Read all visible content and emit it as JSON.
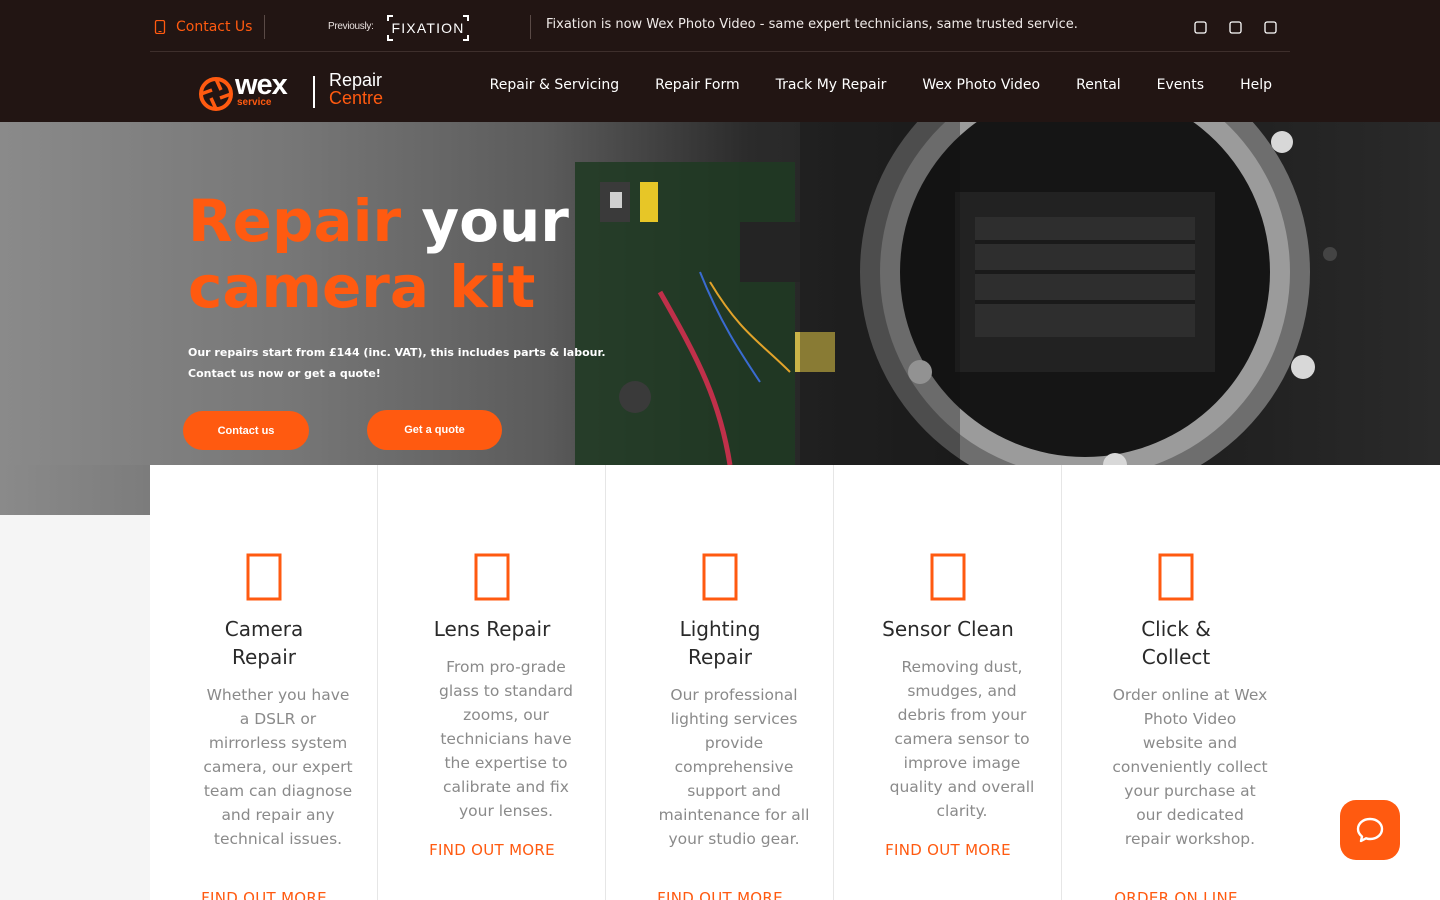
{
  "topbar": {
    "contact_label": "Contact Us",
    "previously_label": "Previously:",
    "previous_brand": "FIXATION",
    "notice": "Fixation is now Wex Photo Video - same expert technicians, same trusted service.",
    "social_icons": [
      "facebook-icon",
      "instagram-icon",
      "twitter-icon"
    ]
  },
  "logo": {
    "brand": "wex",
    "sub": "service",
    "line1": "Repair",
    "line2": "Centre"
  },
  "nav": {
    "items": [
      {
        "label": "Repair & Servicing"
      },
      {
        "label": "Repair Form"
      },
      {
        "label": "Track My Repair"
      },
      {
        "label": "Wex Photo Video"
      },
      {
        "label": "Rental"
      },
      {
        "label": "Events"
      },
      {
        "label": "Help"
      }
    ]
  },
  "hero": {
    "headline_1a": "Repair",
    "headline_1b": " your",
    "headline_2": "camera kit",
    "sub_line1": "Our repairs start from £144 (inc. VAT), this includes parts & labour.",
    "sub_line2": "Contact us now or get a quote!",
    "contact_button": "Contact us",
    "quote_button": "Get a quote"
  },
  "services": [
    {
      "icon": "camera-icon",
      "title": "Camera Repair",
      "desc": "Whether you have a DSLR or mirrorless system camera, our expert team can diagnose and repair any technical issues.",
      "link": "FIND OUT MORE"
    },
    {
      "icon": "lens-icon",
      "title": "Lens Repair",
      "desc": "From pro-grade glass to standard zooms, our technicians have the expertise to calibrate and fix your lenses.",
      "link": "FIND OUT MORE"
    },
    {
      "icon": "lightbulb-icon",
      "title": "Lighting Repair",
      "desc": "Our professional lighting services provide comprehensive support and maintenance for all your studio gear.",
      "link": "FIND OUT MORE"
    },
    {
      "icon": "sensor-icon",
      "title": "Sensor Clean",
      "desc": "Removing dust, smudges, and debris from your camera sensor to improve image quality and overall clarity.",
      "link": "FIND OUT MORE"
    },
    {
      "icon": "store-icon",
      "title": "Click & Collect",
      "desc": "Order online at Wex Photo Video website and conveniently collect your purchase at our dedicated repair workshop.",
      "link": "ORDER ON LINE"
    }
  ],
  "colors": {
    "accent": "#ff5a10",
    "header_bg": "#221513"
  }
}
